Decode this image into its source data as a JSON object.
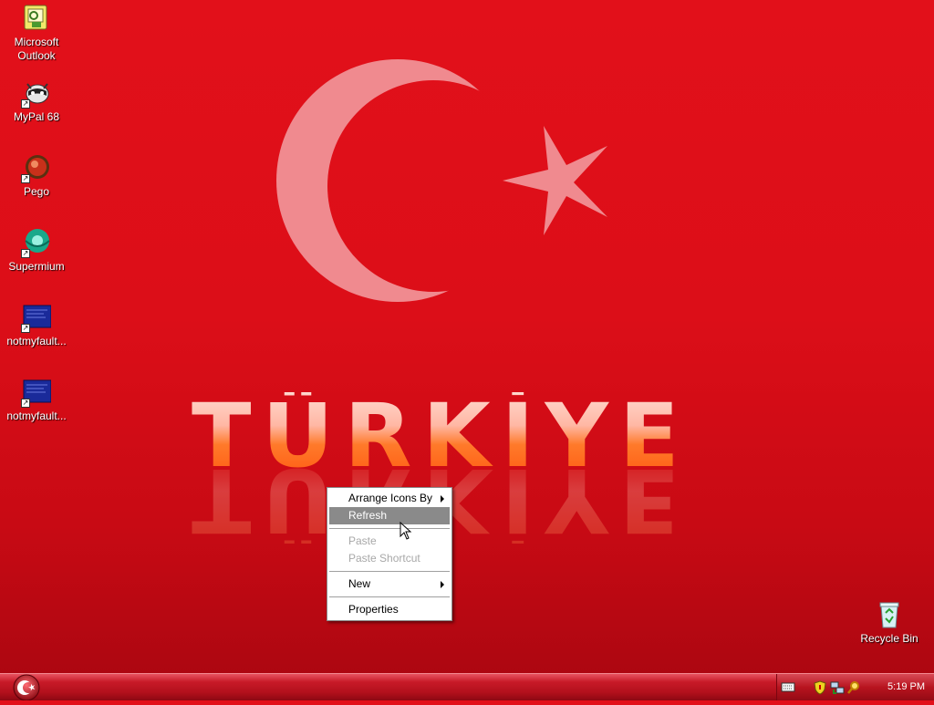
{
  "desktop": {
    "icons": [
      {
        "label": "Microsoft\nOutlook",
        "icon": "outlook-icon"
      },
      {
        "label": "MyPal 68",
        "icon": "mypal-icon"
      },
      {
        "label": "Pego",
        "icon": "pego-icon"
      },
      {
        "label": "Supermium",
        "icon": "supermium-icon"
      },
      {
        "label": "notmyfault...",
        "icon": "notmyfault-icon"
      },
      {
        "label": "notmyfault...",
        "icon": "notmyfault-icon"
      },
      {
        "label": "Recycle Bin",
        "icon": "recycle-bin-icon"
      }
    ],
    "wallpaper": {
      "wordmark": "TÜRKİYE",
      "colors": {
        "background": "#e2101a",
        "emblem": "#f08a8f"
      }
    }
  },
  "context_menu": {
    "items": [
      {
        "label": "Arrange Icons By",
        "submenu": true,
        "state": "normal"
      },
      {
        "label": "Refresh",
        "submenu": false,
        "state": "highlighted"
      },
      {
        "label": "Paste",
        "submenu": false,
        "state": "disabled"
      },
      {
        "label": "Paste Shortcut",
        "submenu": false,
        "state": "disabled"
      },
      {
        "label": "New",
        "submenu": true,
        "state": "normal"
      },
      {
        "label": "Properties",
        "submenu": false,
        "state": "normal"
      }
    ]
  },
  "taskbar": {
    "start_icon": "crescent-star-icon",
    "tray_icons": [
      "keyboard-icon",
      "shield-icon",
      "network-icon",
      "search-icon"
    ],
    "clock": "5:19 PM"
  }
}
